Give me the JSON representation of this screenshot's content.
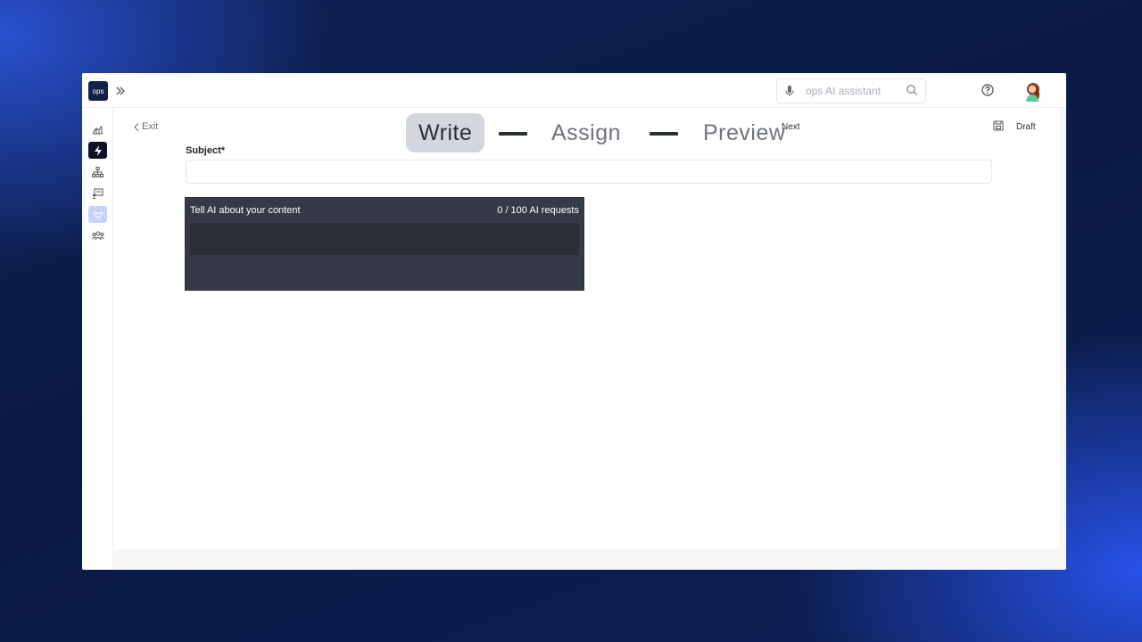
{
  "app": {
    "logo_text": "ops"
  },
  "topbar": {
    "search_placeholder": "ops AI assistant",
    "icons": [
      "expand-icon",
      "mic-icon",
      "search-icon",
      "help-icon",
      "avatar"
    ]
  },
  "sidebar": {
    "items": [
      {
        "name": "analytics",
        "icon": "chart-icon"
      },
      {
        "name": "automations",
        "icon": "lightning-icon",
        "active": true
      },
      {
        "name": "org-chart",
        "icon": "hierarchy-icon"
      },
      {
        "name": "training",
        "icon": "presentation-icon"
      },
      {
        "name": "communications",
        "icon": "handshake-icon",
        "highlighted": true
      },
      {
        "name": "people",
        "icon": "users-icon"
      }
    ]
  },
  "header": {
    "exit_label": "Exit",
    "steps": [
      "Write",
      "Assign",
      "Preview"
    ],
    "active_step": "Write",
    "next_label": "Next",
    "draft_label": "Draft"
  },
  "form": {
    "subject_label": "Subject*",
    "subject_value": ""
  },
  "ai_panel": {
    "title": "Tell AI about your content",
    "requests": "0 / 100 AI requests"
  },
  "colors": {
    "accent_dark": "#0e1226",
    "sidebar_highlight": "#c7d2fb",
    "ai_panel_bg": "#353a46",
    "active_step_bg": "#d2d7de"
  }
}
